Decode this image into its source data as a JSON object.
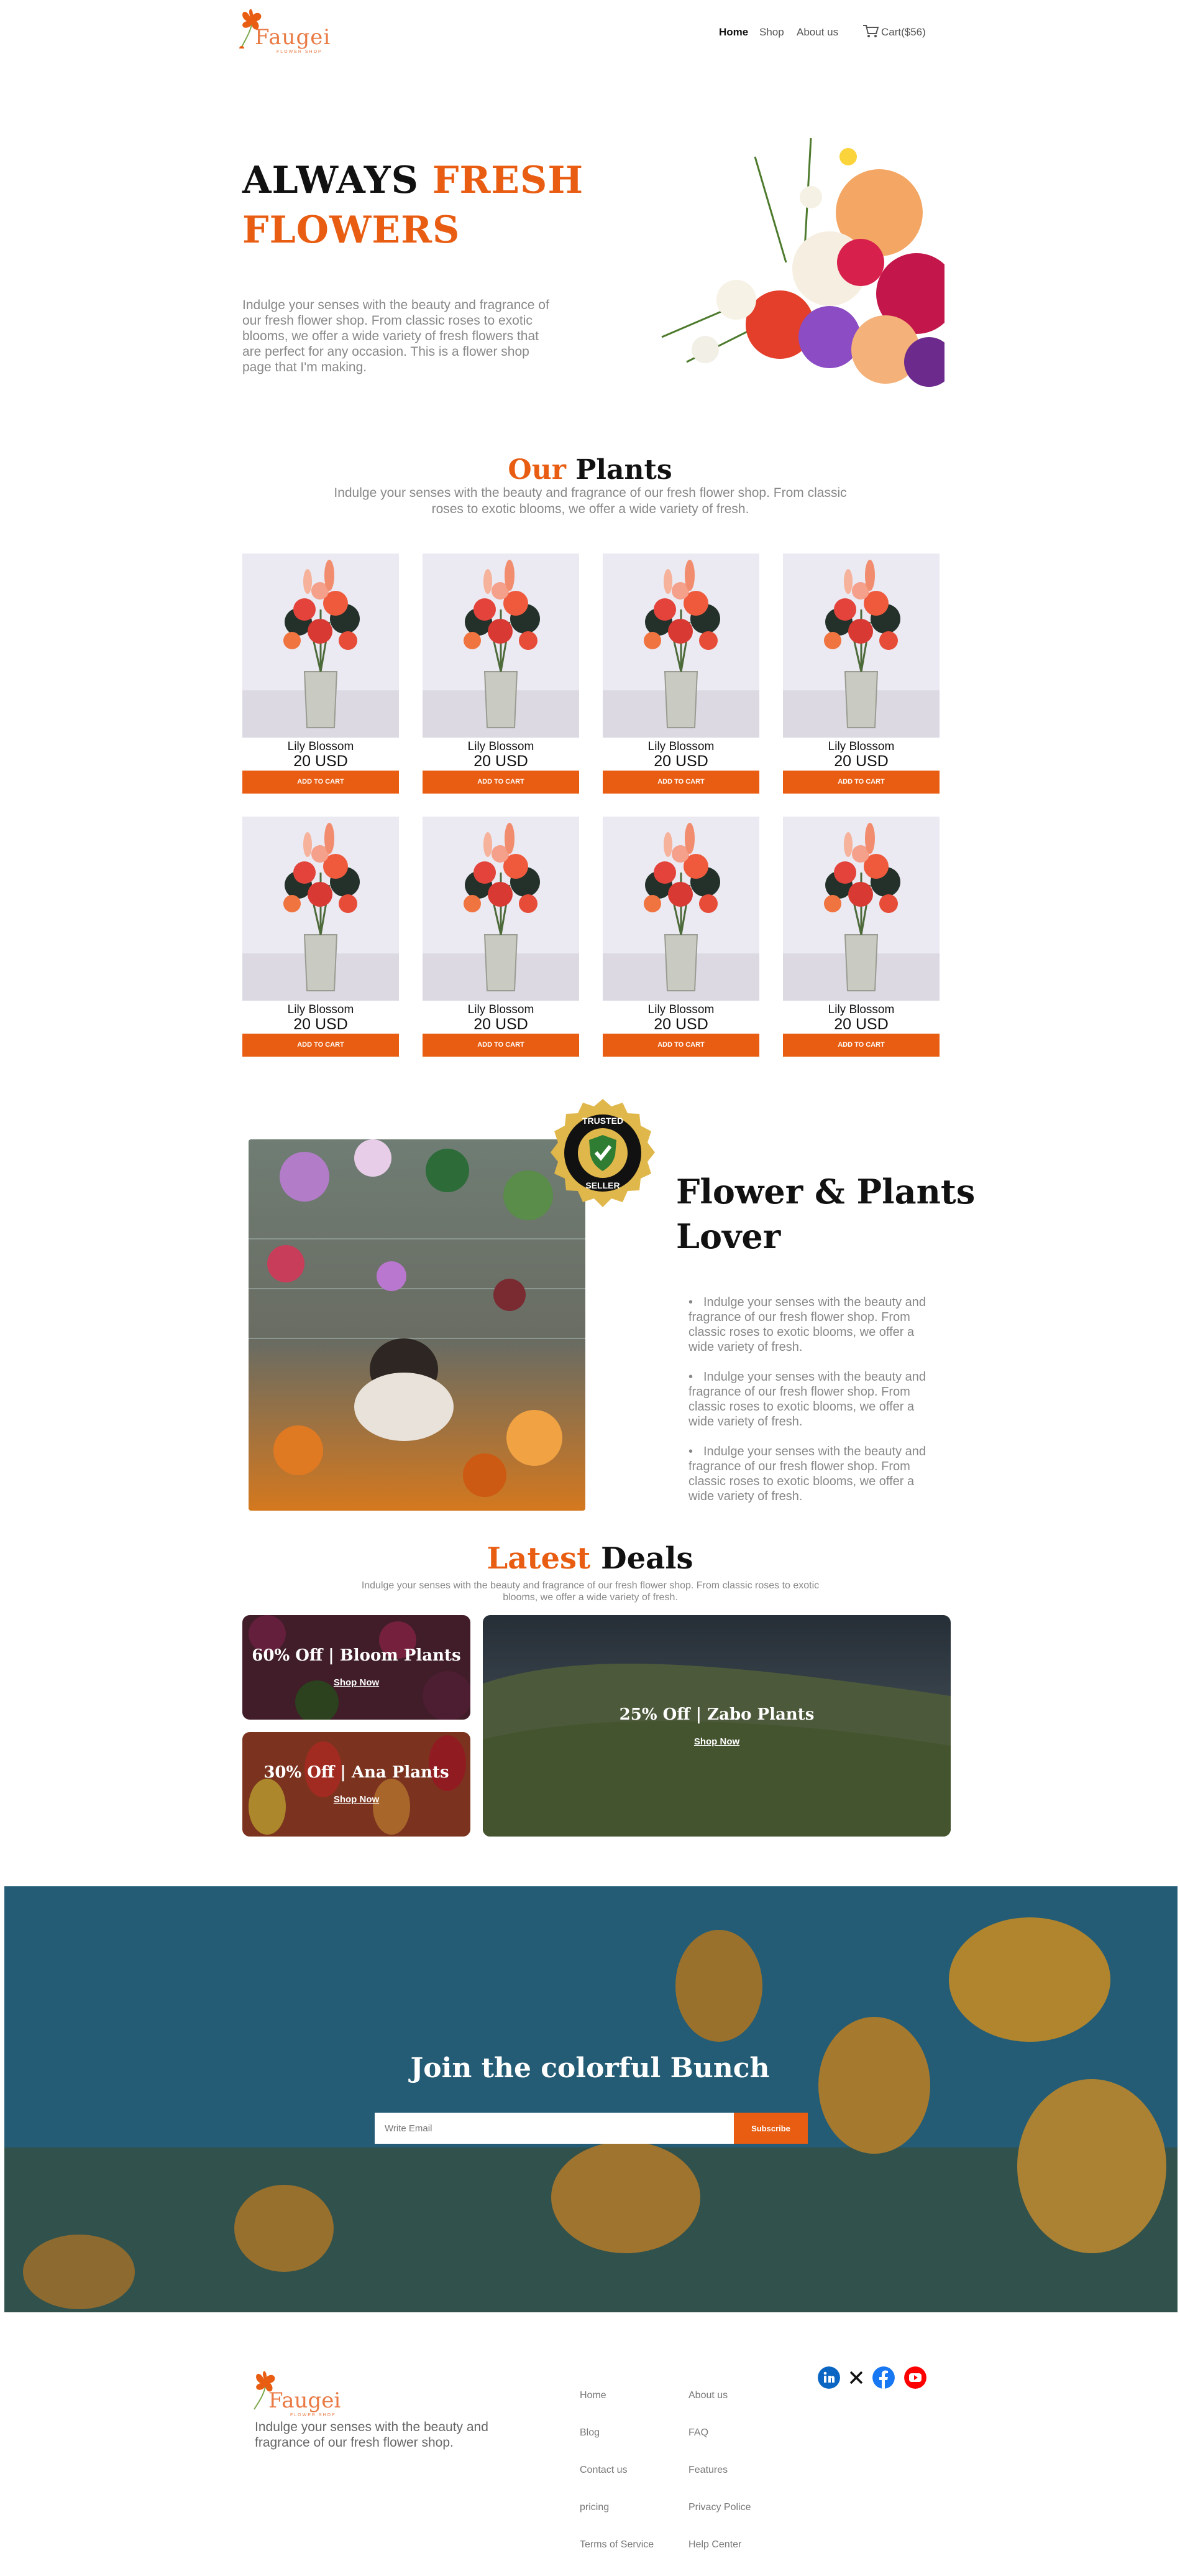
{
  "brand": {
    "name": "Faugei",
    "tagline": "FLOWER SHOP"
  },
  "nav": {
    "home": "Home",
    "shop": "Shop",
    "about": "About us",
    "cart": "Cart($56)"
  },
  "hero": {
    "title_black": "ALWAYS",
    "title_orange_1": "FRESH",
    "title_orange_2": "FLOWERS",
    "text": "Indulge your senses with the beauty and fragrance of our fresh flower shop. From classic roses to exotic blooms, we offer a wide variety of fresh flowers that are perfect for any occasion. This is a flower shop page that I'm making."
  },
  "plants": {
    "title_orange": "Our",
    "title_black": "Plants",
    "subtitle": "Indulge your senses with the beauty and fragrance of our fresh flower shop. From classic roses to exotic blooms, we offer a wide variety of fresh.",
    "items": [
      {
        "name": "Lily Blossom",
        "price": "20 USD",
        "button": "ADD TO CART"
      },
      {
        "name": "Lily Blossom",
        "price": "20 USD",
        "button": "ADD TO CART"
      },
      {
        "name": "Lily Blossom",
        "price": "20 USD",
        "button": "ADD TO CART"
      },
      {
        "name": "Lily Blossom",
        "price": "20 USD",
        "button": "ADD TO CART"
      },
      {
        "name": "Lily Blossom",
        "price": "20 USD",
        "button": "ADD TO CART"
      },
      {
        "name": "Lily Blossom",
        "price": "20 USD",
        "button": "ADD TO CART"
      },
      {
        "name": "Lily Blossom",
        "price": "20 USD",
        "button": "ADD TO CART"
      },
      {
        "name": "Lily Blossom",
        "price": "20 USD",
        "button": "ADD TO CART"
      }
    ]
  },
  "lover": {
    "title_1": "Flower & Plants",
    "title_2": "Lover",
    "badge_top": "TRUSTED",
    "badge_bottom": "SELLER",
    "bullets": [
      "Indulge your senses with the beauty and fragrance of our fresh flower shop. From classic roses to exotic blooms, we offer a wide variety of fresh.",
      "Indulge your senses with the beauty and fragrance of our fresh flower shop. From classic roses to exotic blooms, we offer a wide variety of fresh.",
      "Indulge your senses with the beauty and fragrance of our fresh flower shop. From classic roses to exotic blooms, we offer a wide variety of fresh."
    ]
  },
  "deals": {
    "title_orange": "Latest",
    "title_black": "Deals",
    "subtitle": "Indulge your senses with the beauty and fragrance of our fresh flower shop. From classic roses to exotic blooms, we offer a wide variety of fresh.",
    "items": [
      {
        "title": "60% Off | Bloom Plants",
        "link": "Shop Now"
      },
      {
        "title": "30% Off | Ana Plants",
        "link": "Shop Now"
      },
      {
        "title": "25% Off | Zabo Plants",
        "link": "Shop Now"
      }
    ]
  },
  "newsletter": {
    "title": "Join the colorful Bunch",
    "placeholder": "Write Email",
    "button": "Subscribe"
  },
  "footer": {
    "text": "Indulge your senses with the beauty and fragrance of our fresh flower shop.",
    "col1": [
      "Home",
      "Blog",
      "Contact us",
      "pricing",
      "Terms of Service"
    ],
    "col2": [
      "About us",
      "FAQ",
      "Features",
      "Privacy Police",
      "Help Center"
    ],
    "social": [
      "linkedin-icon",
      "x-icon",
      "facebook-icon",
      "youtube-icon"
    ]
  },
  "colors": {
    "accent": "#e85d12",
    "text": "#111111",
    "muted": "#888888"
  }
}
